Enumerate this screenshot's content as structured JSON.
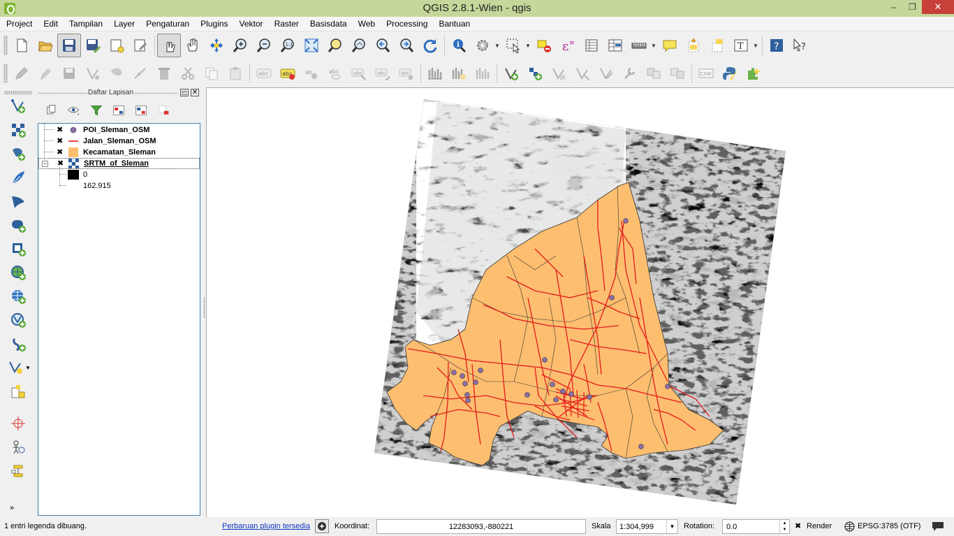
{
  "window": {
    "title": "QGIS 2.8.1-Wien - qgis",
    "minimize": "–",
    "restore": "❐",
    "close": "✕"
  },
  "menubar": [
    "Project",
    "Edit",
    "Tampilan",
    "Layer",
    "Pengaturan",
    "Plugins",
    "Vektor",
    "Raster",
    "Basisdata",
    "Web",
    "Processing",
    "Bantuan"
  ],
  "toolbar1": {
    "icons": [
      "new-project-icon",
      "open-project-icon",
      "save-project-icon",
      "save-as-icon",
      "new-print-composer-icon",
      "composer-manager-icon",
      "touch-pan-icon",
      "pan-map-icon",
      "pan-to-selection-icon",
      "zoom-in-icon",
      "zoom-out-icon",
      "zoom-actual-size-icon",
      "zoom-full-icon",
      "zoom-to-selection-icon",
      "zoom-to-layer-icon",
      "zoom-last-icon",
      "zoom-next-icon",
      "refresh-icon",
      "identify-icon",
      "run-action-icon",
      "select-features-icon",
      "deselect-icon",
      "field-calculator-icon",
      "attribute-table-icon",
      "statistics-icon",
      "measure-line-icon",
      "map-tips-icon",
      "new-bookmark-icon",
      "show-bookmarks-icon",
      "text-annotation-icon",
      "help-icon",
      "whats-this-icon"
    ]
  },
  "toolbar2": {
    "csw_label": "CSW",
    "abc_label": "abc",
    "ab_label": "ab"
  },
  "layer_panel": {
    "title": "Daftar Lapisan",
    "float_glyph": "◰",
    "close_glyph": "✕",
    "layers": [
      {
        "name": "POI_Sleman_OSM",
        "checked": "✖",
        "type": "point"
      },
      {
        "name": "Jalan_Sleman_OSM",
        "checked": "✖",
        "type": "line"
      },
      {
        "name": "Kecamatan_Sleman",
        "checked": "✖",
        "type": "polygon"
      },
      {
        "name": "SRTM_of_Sleman",
        "checked": "✖",
        "type": "raster"
      }
    ],
    "raster_legend": {
      "min": "0",
      "max": "162.915"
    },
    "expand_glyph": "−",
    "collapse_more": "»"
  },
  "colors": {
    "poi_fill": "#8e6da8",
    "road": "#e41a1c",
    "polygon_fill": "#fdbe6f",
    "polygon_stroke": "#333333",
    "title_bar": "#c5d79a",
    "selection_border": "#3c7fb1"
  },
  "statusbar": {
    "message": "1 entri legenda dibuang.",
    "plugin_update": "Perbaruan plugin tersedia",
    "coord_label": "Koordinat:",
    "coord_value": "12283093,-880221",
    "scale_label": "Skala",
    "scale_value": "1:304,999",
    "rotation_label": "Rotation:",
    "rotation_value": "0.0",
    "render_check": "✖",
    "render_label": "Render",
    "crs_label": "EPSG:3785 (OTF)"
  }
}
